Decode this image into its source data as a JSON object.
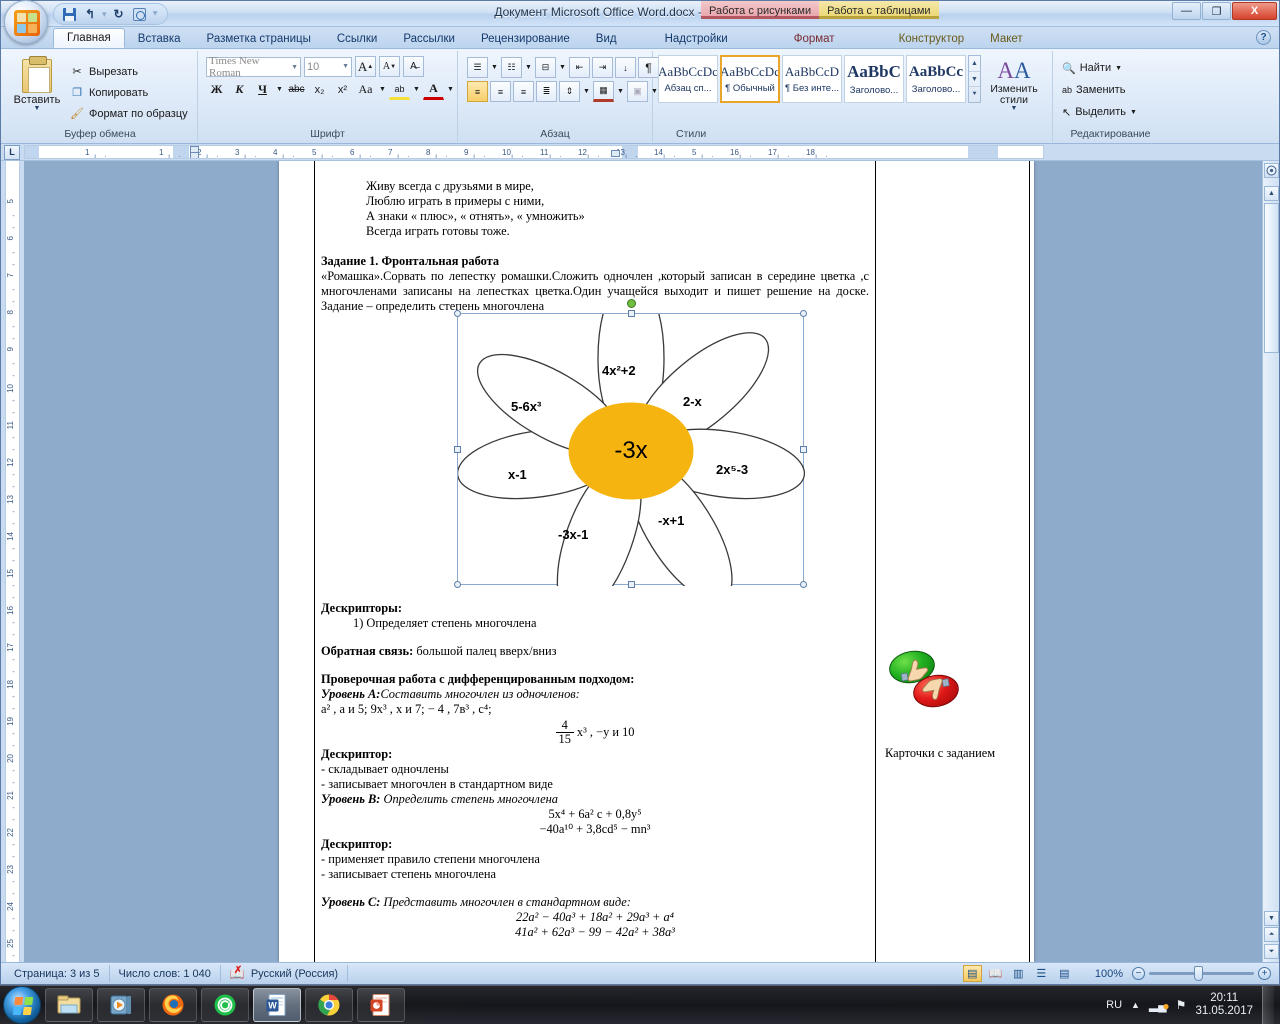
{
  "window": {
    "title": "Документ Microsoft Office Word.docx - Microsoft Word",
    "quick_access": [
      "save-icon",
      "undo-icon",
      "redo-icon",
      "print-preview-icon",
      "customize-icon"
    ],
    "contextual_tabs": [
      {
        "label": "Работа с рисунками",
        "color": "#b4565f"
      },
      {
        "label": "Работа с таблицами",
        "color": "#b8a23a"
      }
    ],
    "controls": {
      "minimize": "—",
      "restore": "❐",
      "close": "X"
    }
  },
  "ribbon": {
    "tabs": [
      {
        "label": "Главная",
        "active": true,
        "kind": "normal"
      },
      {
        "label": "Вставка",
        "active": false,
        "kind": "normal"
      },
      {
        "label": "Разметка страницы",
        "active": false,
        "kind": "normal"
      },
      {
        "label": "Ссылки",
        "active": false,
        "kind": "normal"
      },
      {
        "label": "Рассылки",
        "active": false,
        "kind": "normal"
      },
      {
        "label": "Рецензирование",
        "active": false,
        "kind": "normal"
      },
      {
        "label": "Вид",
        "active": false,
        "kind": "normal"
      },
      {
        "label": "Надстройки",
        "active": false,
        "kind": "normal"
      },
      {
        "label": "Формат",
        "active": false,
        "kind": "ctx"
      },
      {
        "label": "Конструктор",
        "active": false,
        "kind": "ctx2"
      },
      {
        "label": "Макет",
        "active": false,
        "kind": "ctx2"
      }
    ],
    "help_label": "?",
    "groups": {
      "clipboard": {
        "name": "Буфер обмена",
        "paste": "Вставить",
        "cut": "Вырезать",
        "copy": "Копировать",
        "format_painter": "Формат по образцу"
      },
      "font": {
        "name": "Шрифт",
        "font_name": "Times New Roman",
        "font_size": "10",
        "grow": "A",
        "shrink": "A",
        "clear_format": "clear-formatting-icon",
        "bold": "Ж",
        "italic": "К",
        "underline": "Ч",
        "strike": "abc",
        "subscript": "x₂",
        "superscript": "x²",
        "change_case": "Aa",
        "highlight": "ab",
        "font_color": "A"
      },
      "paragraph": {
        "name": "Абзац",
        "bullets": "bullet-list-icon",
        "numbering": "numbered-list-icon",
        "multilevel": "multilevel-list-icon",
        "dec_indent": "decrease-indent-icon",
        "inc_indent": "increase-indent-icon",
        "sort": "sort-icon",
        "show_marks": "¶",
        "align_left": "align-left-icon",
        "align_center": "align-center-icon",
        "align_right": "align-right-icon",
        "justify": "justify-icon",
        "line_spacing": "line-spacing-icon",
        "shading": "shading-icon",
        "borders": "borders-icon"
      },
      "styles": {
        "name": "Стили",
        "items": [
          {
            "sample": "AaBbCcDc",
            "label": "Абзац сп...",
            "active": false
          },
          {
            "sample": "AaBbCcDc",
            "label": "¶ Обычный",
            "active": true
          },
          {
            "sample": "AaBbCcD",
            "label": "¶ Без инте...",
            "active": false
          },
          {
            "sample": "AaBbC",
            "label": "Заголово...",
            "active": false
          },
          {
            "sample": "AaBbCc",
            "label": "Заголово...",
            "active": false
          }
        ],
        "change_styles": "Изменить стили"
      },
      "editing": {
        "name": "Редактирование",
        "find": "Найти",
        "replace": "Заменить",
        "select": "Выделить"
      }
    }
  },
  "rulers": {
    "corner_tab": "L",
    "horizontal_ticks": [
      "1",
      "1",
      "2",
      "3",
      "4",
      "5",
      "6",
      "7",
      "8",
      "9",
      "10",
      "11",
      "12",
      "13",
      "14",
      "15",
      "16",
      "17",
      "18"
    ],
    "vertical_ticks": [
      "5",
      "6",
      "7",
      "8",
      "9",
      "10",
      "11",
      "12",
      "13",
      "14",
      "15",
      "16",
      "17",
      "18",
      "19",
      "20",
      "21",
      "22",
      "23",
      "24",
      "25"
    ]
  },
  "document": {
    "poem": [
      "Живу всегда с друзьями в мире,",
      "Люблю играть в примеры с ними,",
      "А знаки « плюс», « отнять», « умножить»",
      "Всегда играть готовы тоже."
    ],
    "task_heading": "Задание 1. Фронтальная работа",
    "task_body": "«Ромашка».Сорвать по лепестку ромашки.Сложить одночлен ,который записан в середине цветка ,с многочленами записаны на лепестках цветка.Один учащейся выходит и пишет решение на доске. Задание – определить степень многочлена",
    "descriptors_heading": "Дескрипторы:",
    "descriptor_item1": "1)   Определяет степень многочлена",
    "feedback_label": "Обратная связь:",
    "feedback_text": " большой палец вверх/вниз",
    "checkwork_heading": "Проверочная работа с дифференцированным подходом:",
    "levelA_label": "Уровень А:",
    "levelA_task": "Составить многочлен из одночленов:",
    "levelA_line1": "а² , а и 5;   9х³ , х и 7;        − 4 , 7в³ , с⁴;",
    "levelA_frac_num": "4",
    "levelA_frac_den": "15",
    "levelA_frac_tail": "х³ , −у и 10",
    "descriptor2_heading": "Дескриптор:",
    "descriptor2_items": [
      "- складывает одночлены",
      "- записывает многочлен в стандартном виде"
    ],
    "levelB_label": "Уровень В:",
    "levelB_task": " Определить степень многочлена",
    "levelB_line1": "5х⁴ + 6а² с + 0,8у⁵",
    "levelB_line2": "−40а¹⁰ + 3,8cd⁵ − mn³",
    "descriptor3_heading": "Дескриптор:",
    "descriptor3_items": [
      "- применяет правило степени многочлена",
      "- записывает степень многочлена"
    ],
    "levelC_label": "Уровень С:",
    "levelC_task": " Представить многочлен в стандартном виде:",
    "levelC_line1": "22a² − 40a³ + 18a² + 29a³ + a⁴",
    "levelC_line2": "41a² + 62a³ − 99 − 42a² + 38a³",
    "right_caption": "Карточки с заданием"
  },
  "flower": {
    "center_label": "-3x",
    "center_color": "#F5B410",
    "petals": [
      {
        "label": "4x²+2",
        "angle": -90
      },
      {
        "label": "2-x",
        "angle": -40
      },
      {
        "label": "2x⁵-3",
        "angle": 8
      },
      {
        "label": "-x+1",
        "angle": 58
      },
      {
        "label": "-3x-1",
        "angle": 110
      },
      {
        "label": "x-1",
        "angle": 172
      },
      {
        "label": "5-6x³",
        "angle": -150
      }
    ]
  },
  "statusbar": {
    "page": "Страница: 3 из 5",
    "words": "Число слов: 1 040",
    "proofing_icon": "spellcheck-error-icon",
    "language": "Русский (Россия)",
    "views": [
      "print-layout-icon",
      "full-screen-reading-icon",
      "web-layout-icon",
      "outline-icon",
      "draft-icon"
    ],
    "zoom": "100%",
    "zoom_out": "−",
    "zoom_in": "+"
  },
  "taskbar": {
    "start": "start-orb-icon",
    "buttons": [
      {
        "name": "explorer-icon",
        "active": false
      },
      {
        "name": "media-player-icon",
        "active": false
      },
      {
        "name": "firefox-icon",
        "active": false
      },
      {
        "name": "whatsapp-icon",
        "active": false
      },
      {
        "name": "word-icon",
        "active": true
      },
      {
        "name": "chrome-icon",
        "active": false
      },
      {
        "name": "powerpoint-icon",
        "active": false
      }
    ],
    "tray": {
      "language": "RU",
      "icons": [
        "show-hidden-icon",
        "network-icon",
        "action-center-icon"
      ],
      "time": "20:11",
      "date": "31.05.2017"
    }
  }
}
